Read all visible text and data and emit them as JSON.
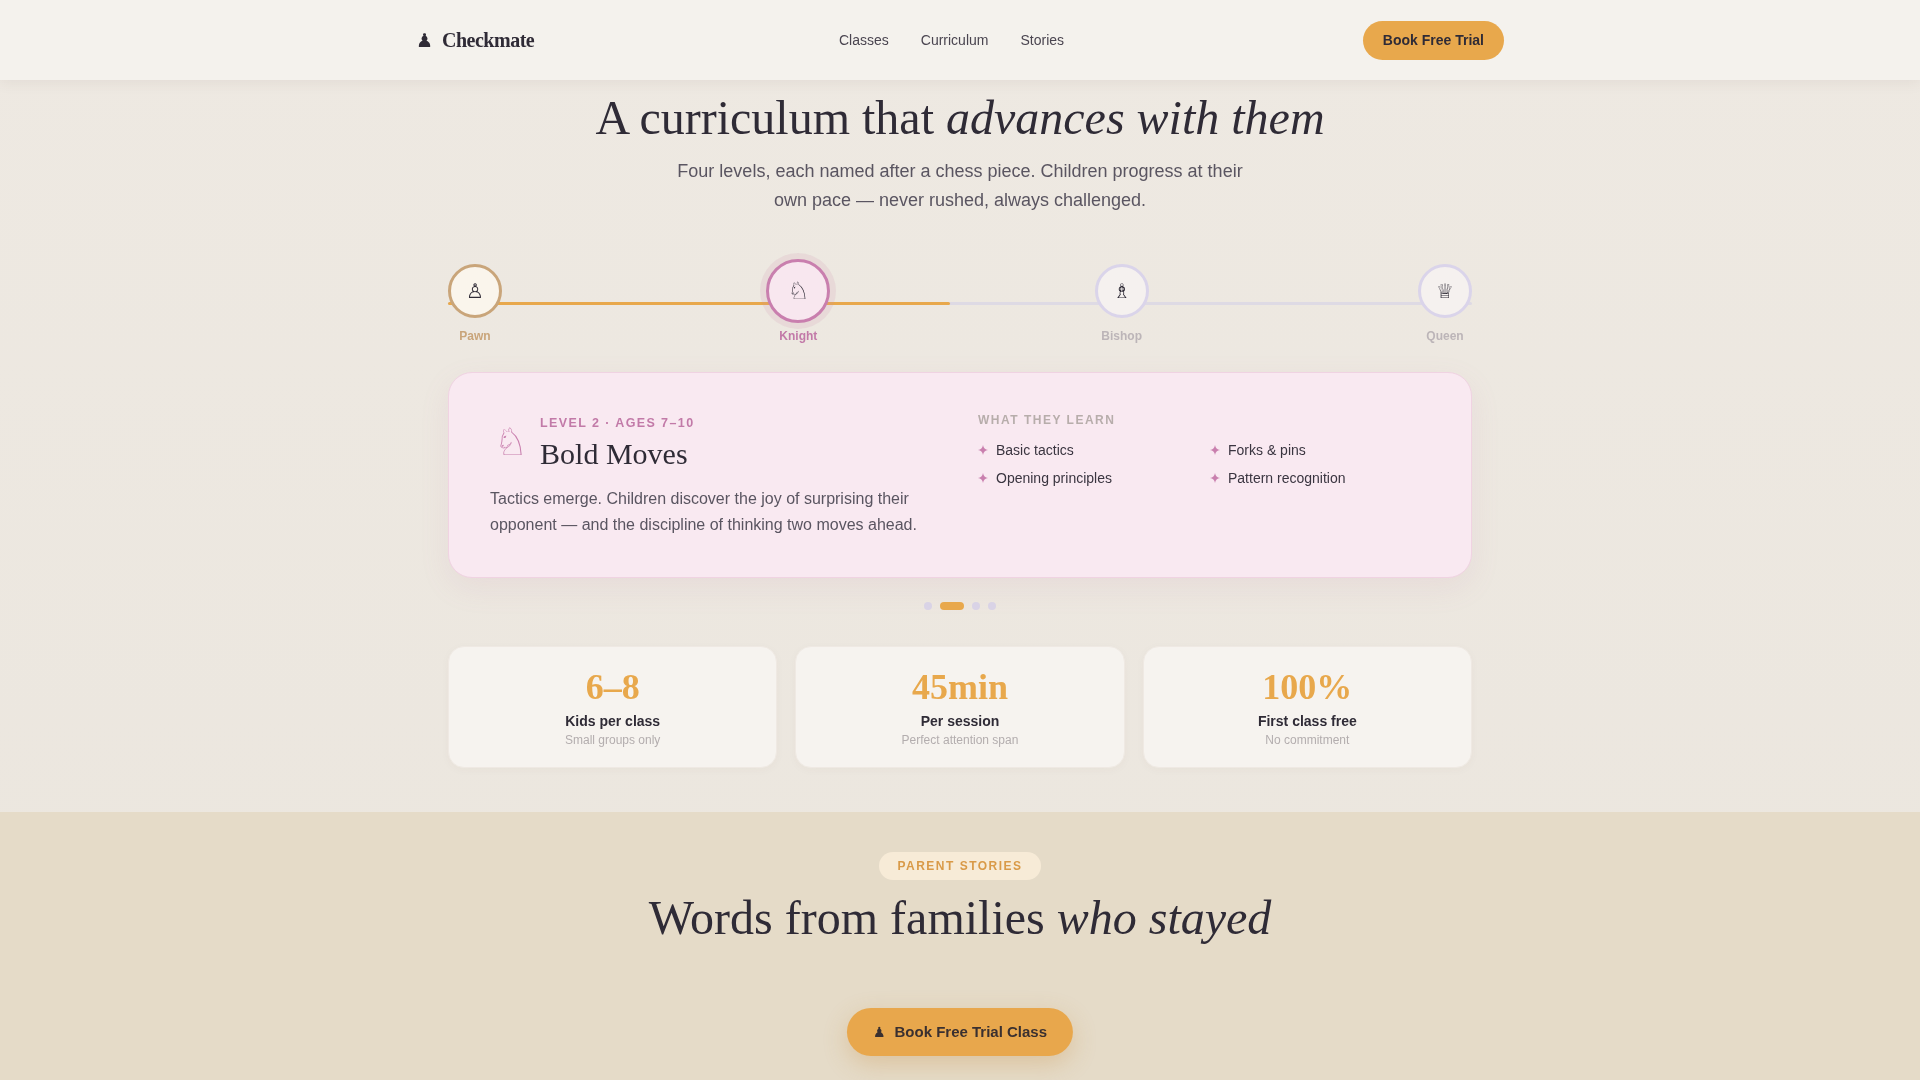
{
  "nav": {
    "logo_icon": "♟",
    "brand": "Checkmate",
    "links": [
      "Classes",
      "Curriculum",
      "Stories"
    ],
    "cta": "Book Free Trial"
  },
  "curriculum": {
    "title": "A curriculum that *advances with them*",
    "subtitle": "Four levels, each named after a chess piece. Children progress at their own pace — never rushed, always challenged.",
    "progress": {
      "level": 0.49
    },
    "levels": [
      {
        "icon": "♙",
        "label": "Pawn",
        "completed": true,
        "selected": false
      },
      {
        "icon": "♘",
        "label": "Knight",
        "completed": false,
        "selected": true
      },
      {
        "icon": "♗",
        "label": "Bishop",
        "completed": false,
        "selected": false
      },
      {
        "icon": "♕",
        "label": "Queen",
        "completed": false,
        "selected": false
      }
    ],
    "detail": {
      "icon": "♘",
      "eyebrow": "LEVEL 2 · AGES 7–10",
      "title": "Bold Moves",
      "description": "Tactics emerge. Children discover the joy of surprising their opponent — and the discipline of thinking two moves ahead.",
      "learn_heading": "WHAT THEY LEARN",
      "learn_items": [
        "Basic tactics",
        "Forks & pins",
        "Opening principles",
        "Pattern recognition"
      ]
    },
    "pager": [
      {
        "selected": false
      },
      {
        "selected": true
      },
      {
        "selected": false
      },
      {
        "selected": false
      }
    ],
    "stats": [
      {
        "value": "6–8",
        "label": "Kids per class",
        "note": "Small groups only"
      },
      {
        "value": "45min",
        "label": "Per session",
        "note": "Perfect attention span"
      },
      {
        "value": "100%",
        "label": "First class free",
        "note": "No commitment"
      }
    ]
  },
  "stories": {
    "badge": "PARENT STORIES",
    "title": "Words from families *who stayed*"
  },
  "floating_cta": {
    "icon": "♟",
    "label": "Book Free Trial Class"
  }
}
